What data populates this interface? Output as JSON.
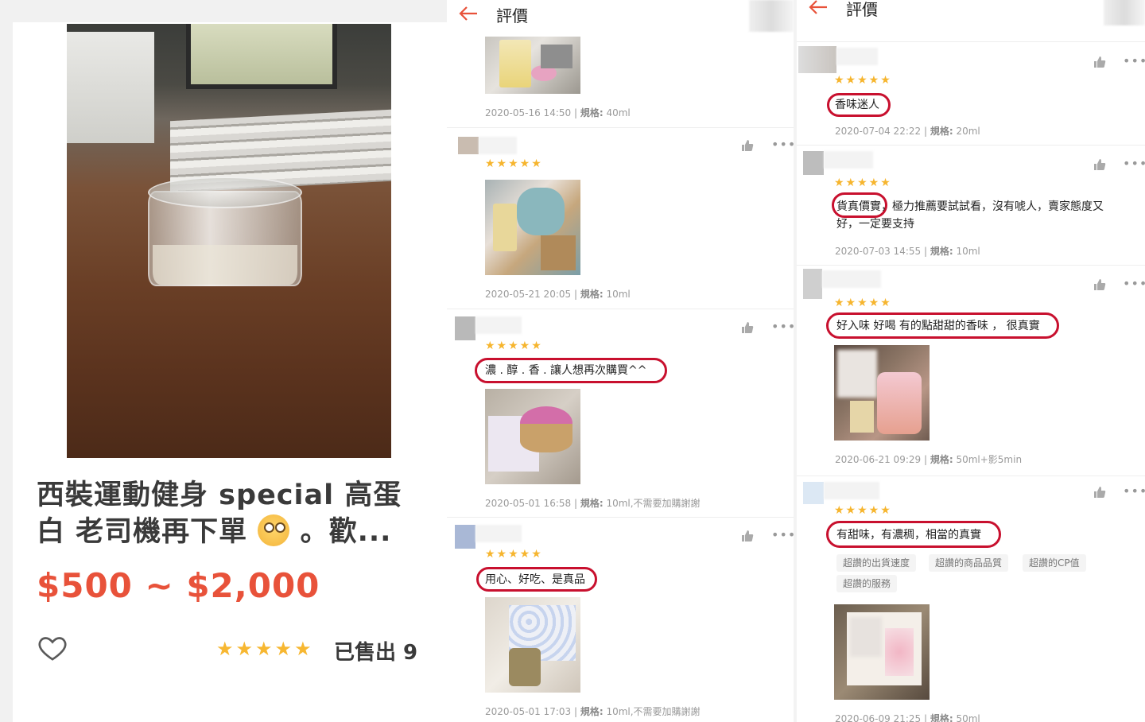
{
  "product": {
    "title_line1": "西裝運動健身 special 高蛋",
    "title_line2": "白 老司機再下單",
    "title_tail": "。歡...",
    "price": "$500 ~ $2,000",
    "rating_stars": "★★★★★",
    "sold": "已售出 9"
  },
  "colors": {
    "accent": "#e8523a",
    "star": "#f6b52e",
    "highlight": "#c8102e"
  },
  "reviews_page_1": {
    "title": "評價",
    "items": [
      {
        "meta_time": "2020-05-16 14:50 | ",
        "meta_label": "規格:",
        "meta_value": " 40ml"
      },
      {
        "stars": "★★★★★",
        "meta_time": "2020-05-21 20:05 | ",
        "meta_label": "規格:",
        "meta_value": " 10ml"
      },
      {
        "stars": "★★★★★",
        "text": "濃 . 醇 . 香 .  讓人想再次購買^^",
        "meta_time": "2020-05-01 16:58 | ",
        "meta_label": "規格:",
        "meta_value": " 10ml,不需要加購謝謝"
      },
      {
        "stars": "★★★★★",
        "text": "用心、好吃、是真品",
        "meta_time": "2020-05-01 17:03 | ",
        "meta_label": "規格:",
        "meta_value": " 10ml,不需要加購謝謝"
      }
    ]
  },
  "reviews_page_2": {
    "title": "評價",
    "items": [
      {
        "stars": "★★★★★",
        "text": "香味迷人",
        "meta_time": "2020-07-04 22:22 | ",
        "meta_label": "規格:",
        "meta_value": " 20ml"
      },
      {
        "stars": "★★★★★",
        "text_line1": "貨真價實，極力推薦要試試看，沒有唬人，賣家態度又",
        "text_line2": "好，一定要支持",
        "meta_time": "2020-07-03 14:55 | ",
        "meta_label": "規格:",
        "meta_value": " 10ml"
      },
      {
        "stars": "★★★★★",
        "text": "好入味 好喝 有的點甜甜的香味 ， 很真實",
        "meta_time": "2020-06-21 09:29 | ",
        "meta_label": "規格:",
        "meta_value": " 50ml+影5min"
      },
      {
        "stars": "★★★★★",
        "text": "有甜味，有濃稠，相當的真實",
        "tags": [
          "超讚的出貨速度",
          "超讚的商品品質",
          "超讚的CP值",
          "超讚的服務"
        ],
        "meta_time": "2020-06-09 21:25 | ",
        "meta_label": "規格:",
        "meta_value": " 50ml"
      }
    ]
  },
  "icons": {
    "back": "arrow-left-icon",
    "like": "thumbs-up-icon",
    "more": "more-dots-icon",
    "favorite": "heart-outline-icon"
  },
  "more_glyph": "•••"
}
